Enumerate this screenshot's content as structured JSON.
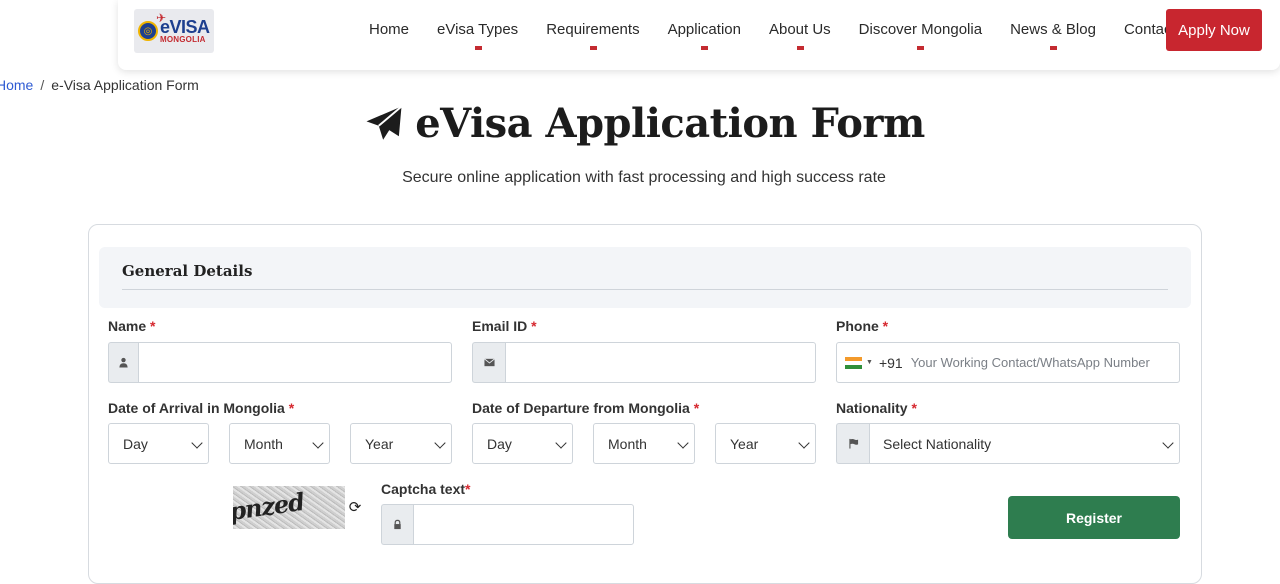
{
  "header": {
    "logo": {
      "title": "eVISA",
      "subtitle": "MONGOLIA"
    },
    "nav": [
      "Home",
      "eVisa Types",
      "Requirements",
      "Application",
      "About Us",
      "Discover Mongolia",
      "News & Blog",
      "Contact"
    ],
    "apply_label": "Apply Now",
    "accent_color": "#c8262f"
  },
  "breadcrumb": {
    "home": "Home",
    "separator": "/",
    "current": "e-Visa Application Form"
  },
  "hero": {
    "icon": "paper-plane-icon",
    "title": "eVisa Application Form",
    "subtitle": "Secure online application with fast processing and high success rate"
  },
  "form": {
    "section_title": "General Details",
    "required_mark": "*",
    "name_label": "Name",
    "email_label": "Email ID",
    "phone_label": "Phone",
    "phone_code": "+91",
    "phone_placeholder": "Your Working Contact/WhatsApp Number",
    "arrival_label": "Date of Arrival in Mongolia",
    "departure_label": "Date of Departure from Mongolia",
    "nationality_label": "Nationality",
    "day": "Day",
    "month": "Month",
    "year": "Year",
    "nationality_select": "Select Nationality",
    "captcha_image_text": "pnzed",
    "captcha_label": "Captcha text",
    "register_label": "Register",
    "register_color": "#2e7d4f"
  }
}
